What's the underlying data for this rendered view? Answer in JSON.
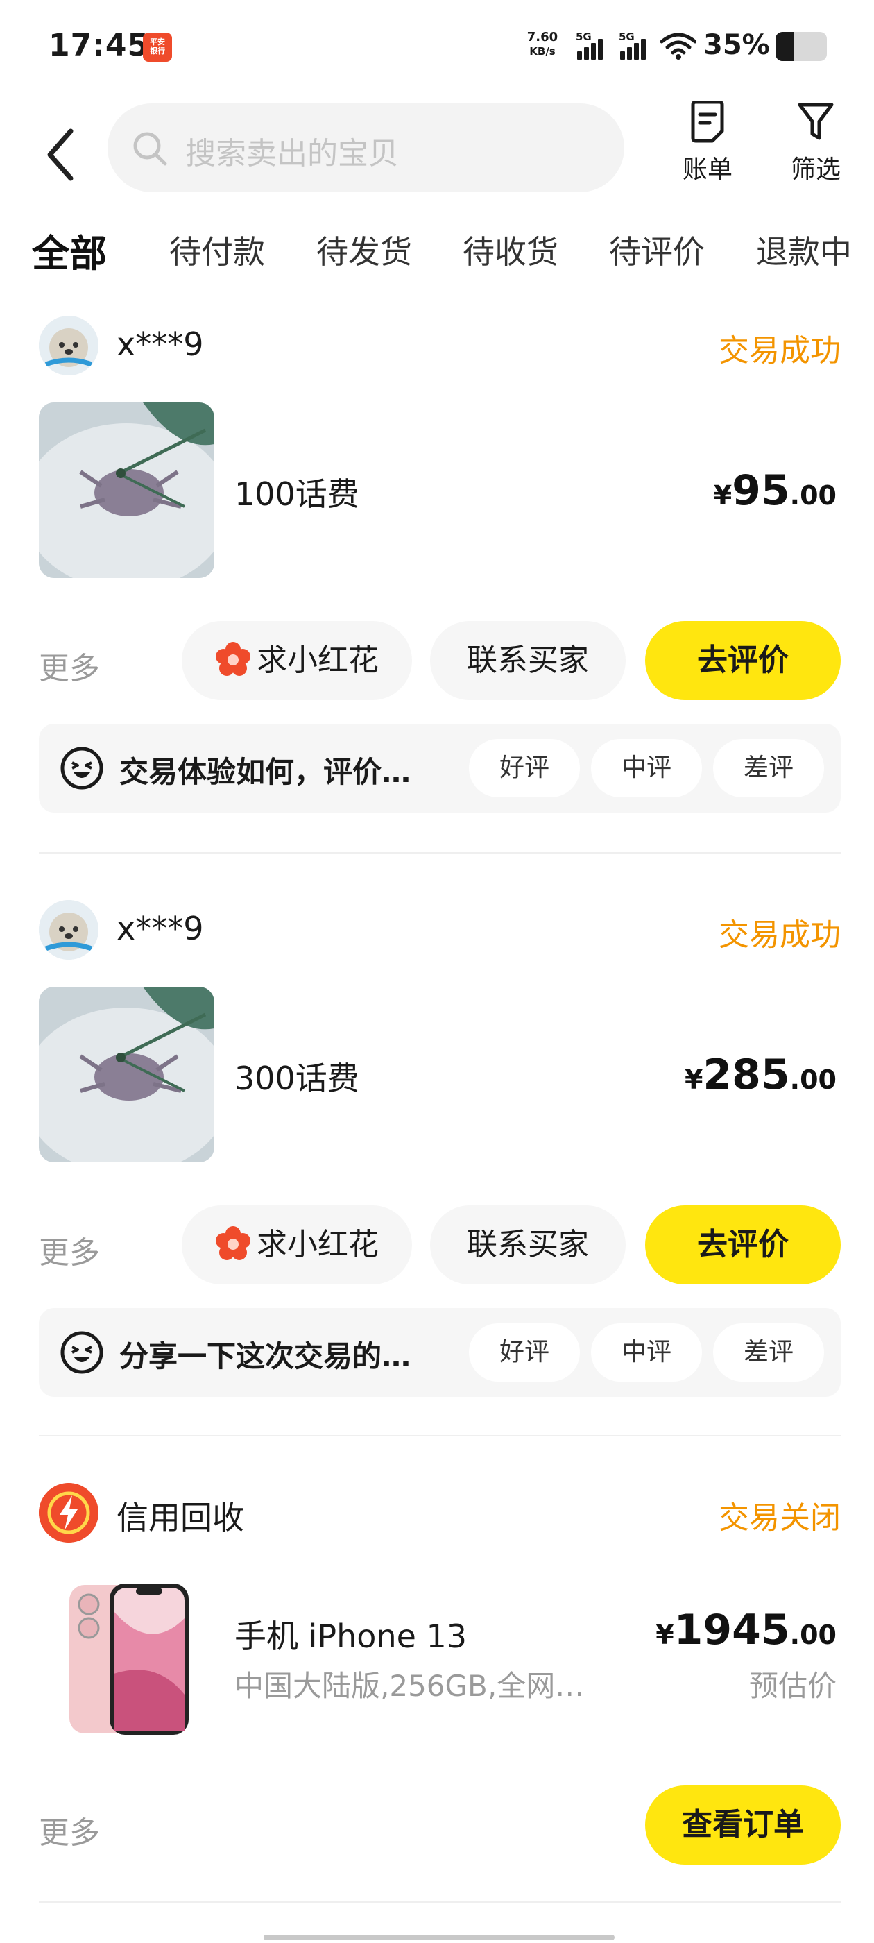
{
  "status_bar": {
    "time": "17:45",
    "bank_badge": "平安\n银行",
    "net_speed_value": "7.60",
    "net_speed_unit": "KB/s",
    "sim1": "5G",
    "sim2": "5G",
    "battery_percent_text": "35%",
    "battery_level": 0.35
  },
  "header": {
    "search_placeholder": "搜索卖出的宝贝",
    "bill_label": "账单",
    "filter_label": "筛选"
  },
  "tabs": [
    {
      "label": "全部",
      "active": true
    },
    {
      "label": "待付款"
    },
    {
      "label": "待发货"
    },
    {
      "label": "待收货"
    },
    {
      "label": "待评价"
    },
    {
      "label": "退款中"
    }
  ],
  "orders": [
    {
      "seller": "x***9",
      "status": "交易成功",
      "title": "100话费",
      "price_currency": "¥",
      "price_int": "95",
      "price_dec": ".00",
      "more": "更多",
      "flower_button": "求小红花",
      "contact_button": "联系买家",
      "review_button": "去评价",
      "rating_prompt": "交易体验如何，评价…",
      "rating_good": "好评",
      "rating_mid": "中评",
      "rating_bad": "差评"
    },
    {
      "seller": "x***9",
      "status": "交易成功",
      "title": "300话费",
      "price_currency": "¥",
      "price_int": "285",
      "price_dec": ".00",
      "more": "更多",
      "flower_button": "求小红花",
      "contact_button": "联系买家",
      "review_button": "去评价",
      "rating_prompt": "分享一下这次交易的…",
      "rating_good": "好评",
      "rating_mid": "中评",
      "rating_bad": "差评"
    },
    {
      "seller": "信用回收",
      "status": "交易关闭",
      "title": "手机 iPhone 13",
      "subtitle": "中国大陆版,256GB,全网…",
      "price_currency": "¥",
      "price_int": "1945",
      "price_dec": ".00",
      "price_note": "预估价",
      "more": "更多",
      "view_order_button": "查看订单"
    }
  ],
  "colors": {
    "accent_yellow": "#ffe60f",
    "status_orange": "#f39400",
    "muted_gray": "#9a9a9a"
  }
}
